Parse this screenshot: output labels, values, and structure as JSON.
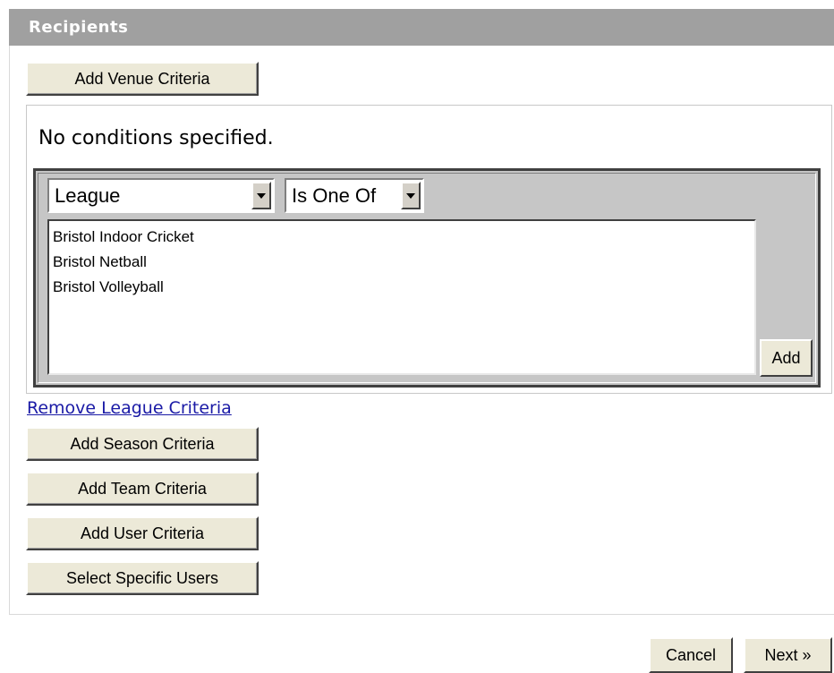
{
  "header": {
    "title": "Recipients"
  },
  "buttons": {
    "add_venue": "Add Venue Criteria",
    "add_season": "Add Season Criteria",
    "add_team": "Add Team Criteria",
    "add_user": "Add User Criteria",
    "select_users": "Select Specific Users",
    "add": "Add",
    "cancel": "Cancel",
    "next": "Next »"
  },
  "conditions": {
    "empty_text": "No conditions specified."
  },
  "criteria": {
    "field_select": "League",
    "operator_select": "Is One Of",
    "options": [
      "Bristol Indoor Cricket",
      "Bristol Netball",
      "Bristol Volleyball"
    ],
    "remove_link": "Remove League Criteria"
  },
  "icons": {
    "dropdown": "chevron-down-icon"
  }
}
